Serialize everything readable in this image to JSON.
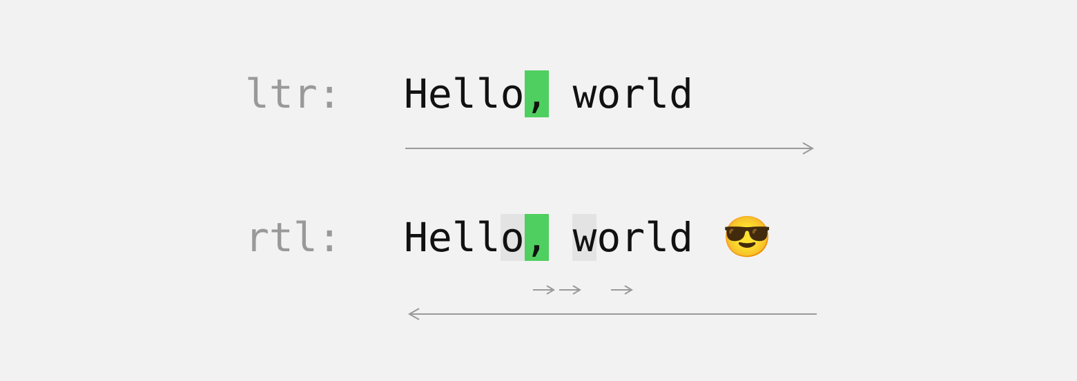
{
  "rows": {
    "ltr": {
      "label": "ltr:",
      "text_before_hl": "Hello",
      "hl": ",",
      "text_after_hl": " world"
    },
    "rtl": {
      "label": "rtl:",
      "text_before_gray1": "Hell",
      "gray1": "o",
      "hl": ",",
      "text_between": " ",
      "gray2": "w",
      "text_after": "orld",
      "emoji": "😎"
    }
  },
  "colors": {
    "highlight_green": "#4fcf5f",
    "highlight_gray": "#e3e3e3",
    "label_gray": "#999999",
    "arrow_gray": "#999999"
  }
}
